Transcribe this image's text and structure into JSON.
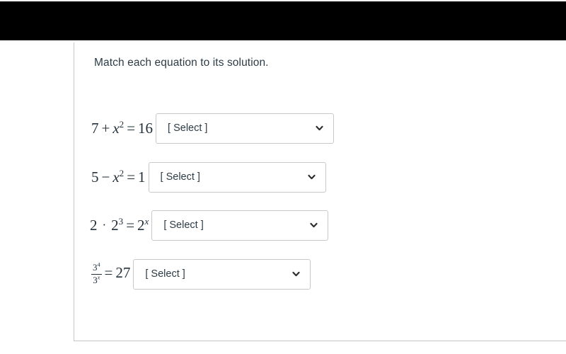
{
  "page": {
    "prompt": "Match each equation to its solution.",
    "border_color": "#c7c7c7",
    "banner_color": "#000000",
    "text_color": "#2d3b45",
    "select_border_color": "#c9c9c9"
  },
  "rows": [
    {
      "equation_text": "7 + x² = 16",
      "parts": {
        "a": "7",
        "op": "+",
        "base": "x",
        "exp": "2",
        "eq": "=",
        "result": "16"
      },
      "select": {
        "label": "[ Select ]",
        "icon": "chevron-down-icon"
      }
    },
    {
      "equation_text": "5 − x² = 1",
      "parts": {
        "a": "5",
        "op": "−",
        "base": "x",
        "exp": "2",
        "eq": "=",
        "result": "1"
      },
      "select": {
        "label": "[ Select ]",
        "icon": "chevron-down-icon"
      }
    },
    {
      "equation_text": "2 · 2³ = 2ˣ",
      "parts": {
        "a": "2",
        "op": "·",
        "base": "2",
        "exp": "3",
        "eq": "=",
        "result_base": "2",
        "result_exp": "x"
      },
      "select": {
        "label": "[ Select ]",
        "icon": "chevron-down-icon"
      }
    },
    {
      "equation_text": "3⁴ / 3ˣ = 27",
      "parts": {
        "num_base": "3",
        "num_exp": "4",
        "den_base": "3",
        "den_exp": "x",
        "eq": "=",
        "result": "27"
      },
      "select": {
        "label": "[ Select ]",
        "icon": "chevron-down-icon"
      }
    }
  ]
}
